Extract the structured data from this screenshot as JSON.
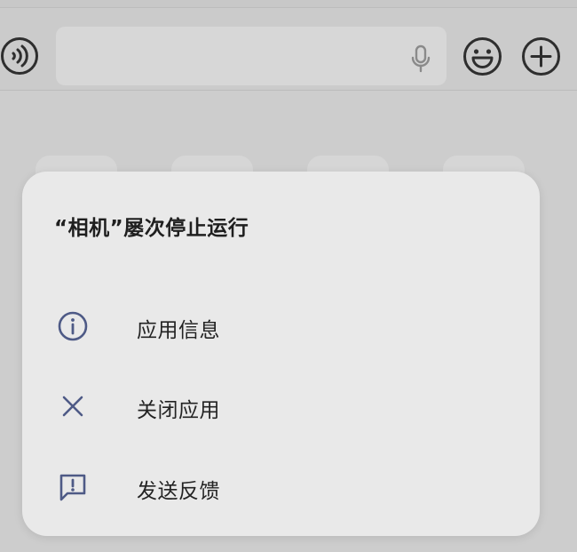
{
  "dialog": {
    "title": "“相机”屡次停止运行",
    "items": [
      {
        "label": "应用信息",
        "icon": "info-icon"
      },
      {
        "label": "关闭应用",
        "icon": "close-icon"
      },
      {
        "label": "发送反馈",
        "icon": "feedback-icon"
      }
    ]
  },
  "input_bar": {
    "icons": [
      "voice-toggle-icon",
      "microphone-icon",
      "emoji-icon",
      "plus-icon"
    ]
  },
  "colors": {
    "dialog_background": "#e9e9e9",
    "icon_accent": "#4e5a86",
    "screen_dim": "#cdcdcd"
  }
}
